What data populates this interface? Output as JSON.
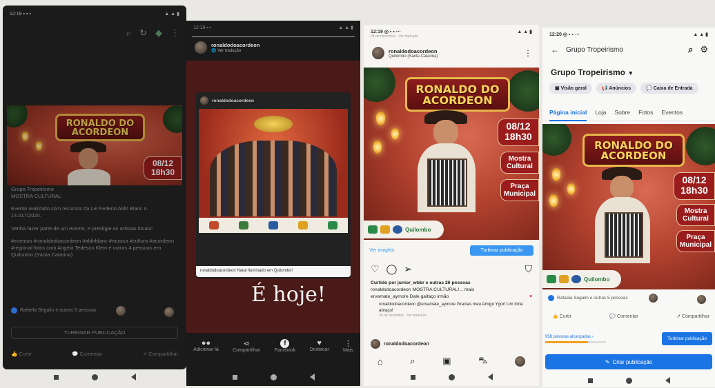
{
  "poster": {
    "title_line1": "RONALDO DO",
    "title_line2": "ACORDEON",
    "date": "08/12",
    "time": "18h30",
    "label_mostra_1": "Mostra",
    "label_mostra_2": "Cultural",
    "label_praca_1": "Praça",
    "label_praca_2": "Municipal",
    "logo_text": "Quilombo"
  },
  "phone1": {
    "group": "Grupo Tropeirismo",
    "event_title": "MOSTRA CULTURAL",
    "event_desc": "Evento realizado com recursos da Lei Federal Aldir Blanc n. 14.017/2020.",
    "invite": "Venha fazer parte de um evento, e prestigie os artistas locais!",
    "tags": "#eventos #ronaldodoacordeon #aldirblanc #musica #cultura #acordeon #regional fotos com Angela Tedesco Klein e outras 4 pessoas em Quilombo (Santa Catarina)",
    "reactions": "Rafaela Segalin e outras 5 pessoas",
    "boost": "TURBINAR PUBLICAÇÃO",
    "like": "Curtir",
    "comment": "Comentar",
    "share": "Compartilhar"
  },
  "phone2": {
    "username": "ronaldodoacordeon",
    "see_translation": "Ver tradução",
    "inner_user": "ronaldodoacordeon",
    "caption": "ronaldodoacordeon Natal Iluminado em Quilombo!",
    "overlay_text": "É hoje!",
    "actions": [
      "Adicionar lá",
      "Compartilhar",
      "Facebook",
      "Destacar",
      "Mais"
    ]
  },
  "phone3": {
    "time": "12:19",
    "status_sub": "28 de novembro · Ver tradução",
    "username": "ronaldodoacordeon",
    "location": "Quilombo (Santa Catarina)",
    "insights": "Ver insights",
    "boost": "Turbinar publicação",
    "liked_by": "Curtido por junior_wbbr e outras 26 pessoas",
    "caption": "ronaldodoacordeon MOSTRA CULTURAL!... mais",
    "comment1": "ervamate_aymore Dale gaitaço irmão",
    "reply": "ronaldodoacordeon @ervamate_aymore Gracias meu Amigo Ygor! Um forte abraço!",
    "reply_meta": "2d de novembro · Ver tradução",
    "next_user": "ronaldodoacordeon"
  },
  "phone4": {
    "time": "12:20",
    "header_title": "Grupo Tropeirismo",
    "group_name": "Grupo Tropeirismo",
    "chips": [
      "Visão geral",
      "Anúncios",
      "Caixa de Entrada"
    ],
    "tabs": [
      "Página inicial",
      "Loja",
      "Sobre",
      "Fotos",
      "Eventos"
    ],
    "reactions": "Rafaela Segalin e outras 5 pessoas",
    "like": "Curtir",
    "comment": "Comentar",
    "share": "Compartilhar",
    "reach": "958 pessoas alcançadas ›",
    "boost": "Turbinar publicação",
    "create": "Criar publicação"
  },
  "colors": {
    "fb_blue": "#1b74e4",
    "ig_blue": "#3897f0",
    "poster_red": "#b3422f",
    "gold": "#f5d35a"
  }
}
